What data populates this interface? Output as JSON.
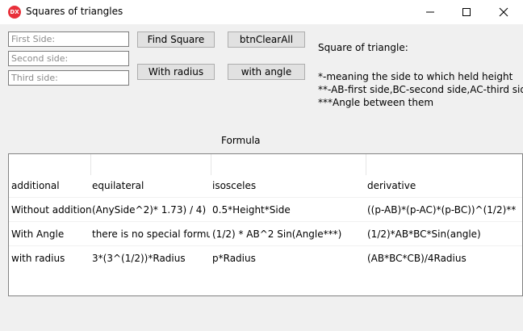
{
  "window": {
    "title": "Squares of triangles",
    "icon_text": "DX"
  },
  "inputs": {
    "first_side_placeholder": "First Side:",
    "second_side_placeholder": "Second side:",
    "third_side_placeholder": "Third side:"
  },
  "buttons": {
    "find_square": "Find Square",
    "clear_all": "btnClearAll",
    "with_radius": "With radius",
    "with_angle": "with angle"
  },
  "result": {
    "label": "Square of triangle:"
  },
  "notes": [
    "*-meaning the side to which held height",
    "**-AB-first side,BC-second side,AC-third side",
    "***Angle between them"
  ],
  "formula_label": "Formula",
  "table": {
    "header": [
      "additional",
      "equilateral",
      "isosceles",
      "derivative"
    ],
    "rows": [
      [
        "Without additional",
        "(AnySide^2)* 1.73) / 4)",
        "0.5*Height*Side",
        "((p-AB)*(p-AC)*(p-BC))^(1/2)**"
      ],
      [
        "With Angle",
        "there is no special formule",
        "(1/2) * AB^2 Sin(Angle***)",
        "(1/2)*AB*BC*Sin(angle)"
      ],
      [
        "with radius",
        "3*(3^(1/2))*Radius",
        "p*Radius",
        "(AB*BC*CB)/4Radius"
      ]
    ]
  }
}
